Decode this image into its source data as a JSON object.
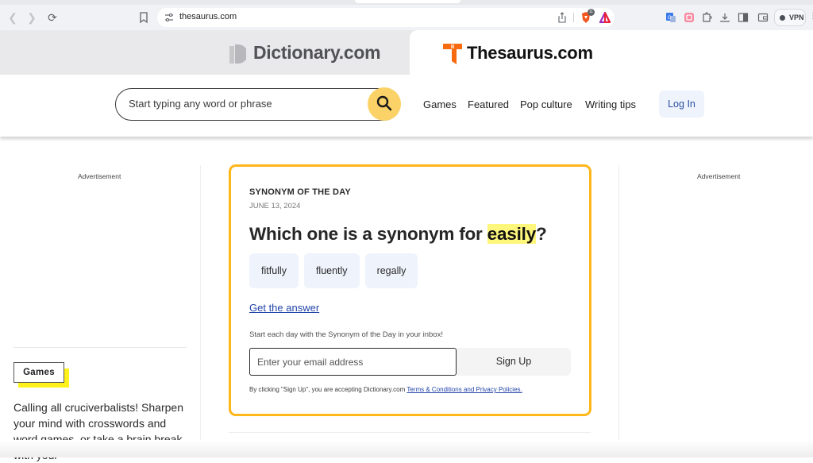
{
  "browser": {
    "url": "thesaurus.com",
    "brave_badge_count": "11",
    "vpn_label": "VPN"
  },
  "site_tabs": {
    "dictionary": "Dictionary.com",
    "thesaurus": "Thesaurus.com"
  },
  "header": {
    "search_placeholder": "Start typing any word or phrase",
    "nav_links": [
      "Games",
      "Featured",
      "Pop culture",
      "Writing tips"
    ],
    "login_label": "Log In"
  },
  "sidebar_left": {
    "ad_label": "Advertisement",
    "games_tag": "Games",
    "games_description": "Calling all cruciverbalists! Sharpen your mind with crosswords and word games, or take a brain break with your"
  },
  "sidebar_right": {
    "ad_label": "Advertisement"
  },
  "synonym_of_the_day": {
    "eyebrow": "SYNONYM OF THE DAY",
    "date": "JUNE 13, 2024",
    "question_prefix": "Which one is a synonym for ",
    "word": "easily",
    "question_suffix": "?",
    "options": [
      "fitfully",
      "fluently",
      "regally"
    ],
    "get_answer_label": "Get the answer",
    "promo_text": "Start each day with the Synonym of the Day in your inbox!",
    "email_placeholder": "Enter your email address",
    "signup_label": "Sign Up",
    "terms_prefix": "By clicking \"Sign Up\", you are accepting Dictionary.com ",
    "terms_link": "Terms & Conditions and Privacy Policies."
  },
  "colors": {
    "accent_orange": "#fdb71b",
    "search_button": "#fbd267",
    "highlight_yellow": "#fff67c",
    "games_shadow": "#fff21c",
    "link_blue": "#2345a9",
    "thesaurus_logo": "#f86a0f"
  }
}
